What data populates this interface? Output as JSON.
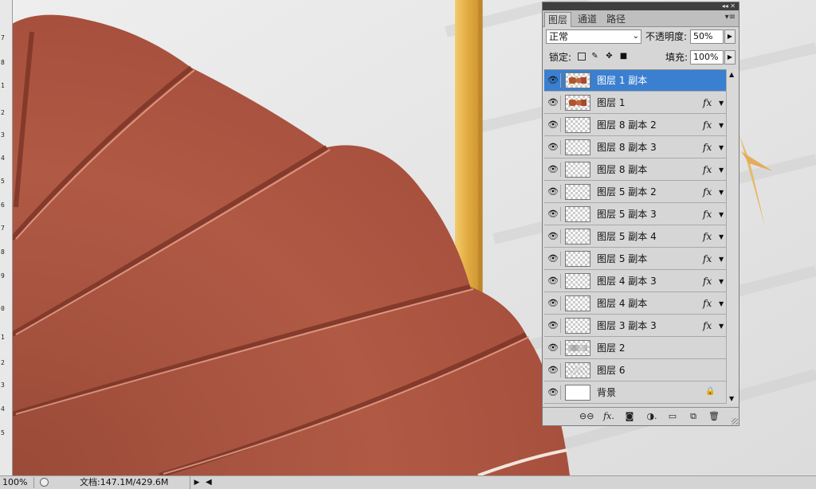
{
  "canvas": {
    "status_zoom": "100%",
    "doc_info": "文档:147.1M/429.6M",
    "ruler_numbers": [
      "7",
      "8",
      "1",
      "2",
      "3",
      "4",
      "5",
      "6",
      "7",
      "8",
      "9",
      "0",
      "1",
      "2",
      "3",
      "4",
      "5"
    ]
  },
  "panel": {
    "tabs": [
      {
        "label": "图层",
        "active": true
      },
      {
        "label": "通道",
        "active": false
      },
      {
        "label": "路径",
        "active": false
      }
    ],
    "blend_mode": "正常",
    "opacity_label": "不透明度:",
    "opacity_value": "50%",
    "lock_label": "锁定:",
    "fill_label": "填充:",
    "fill_value": "100%",
    "layers": [
      {
        "name": "图层 1 副本",
        "thumb": "art",
        "fx": "",
        "selected": true
      },
      {
        "name": "图层 1",
        "thumb": "art",
        "fx": "fx",
        "selected": false
      },
      {
        "name": "图层 8 副本 2",
        "thumb": "transparent",
        "fx": "fx",
        "selected": false
      },
      {
        "name": "图层 8 副本 3",
        "thumb": "transparent",
        "fx": "fx",
        "selected": false
      },
      {
        "name": "图层 8 副本",
        "thumb": "transparent",
        "fx": "fx",
        "selected": false
      },
      {
        "name": "图层 5 副本 2",
        "thumb": "transparent",
        "fx": "fx",
        "selected": false
      },
      {
        "name": "图层 5 副本 3",
        "thumb": "transparent",
        "fx": "fx",
        "selected": false
      },
      {
        "name": "图层 5 副本 4",
        "thumb": "transparent",
        "fx": "fx",
        "selected": false
      },
      {
        "name": "图层 5 副本",
        "thumb": "transparent",
        "fx": "fx",
        "selected": false
      },
      {
        "name": "图层 4 副本 3",
        "thumb": "transparent",
        "fx": "fx",
        "selected": false
      },
      {
        "name": "图层 4 副本",
        "thumb": "transparent",
        "fx": "fx",
        "selected": false
      },
      {
        "name": "图层 3 副本 3",
        "thumb": "transparent",
        "fx": "fx",
        "selected": false
      },
      {
        "name": "图层 2",
        "thumb": "gray",
        "fx": "",
        "selected": false
      },
      {
        "name": "图层 6",
        "thumb": "sketch",
        "fx": "",
        "selected": false
      },
      {
        "name": "背景",
        "thumb": "white",
        "fx": "",
        "selected": false,
        "locked": true
      }
    ]
  },
  "colors": {
    "selection": "#3a7fd0",
    "fan": "#a8523f",
    "frame": "#e3b14a"
  }
}
